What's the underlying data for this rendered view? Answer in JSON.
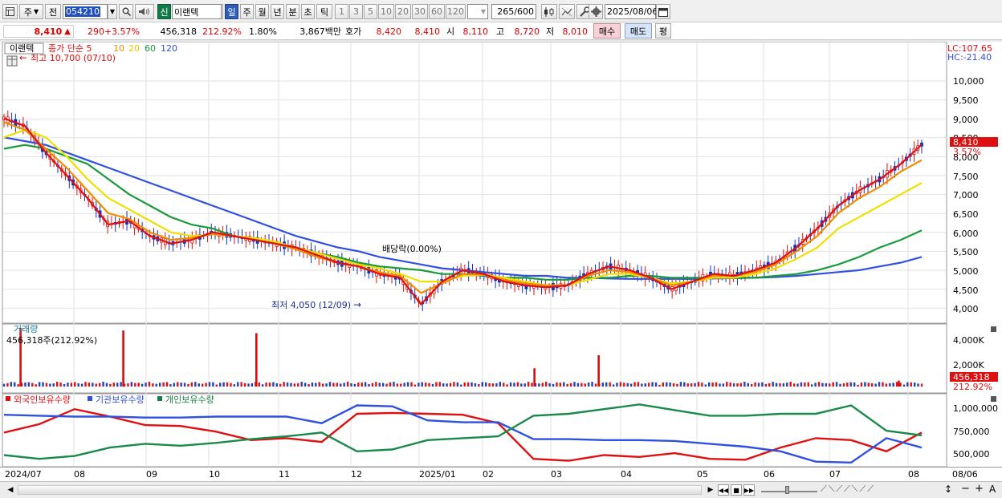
{
  "toolbar": {
    "type_label": "주",
    "prev_label": "전",
    "code": "054210",
    "new_badge": "신",
    "name": "이랜텍",
    "periods": [
      "일",
      "주",
      "월",
      "년",
      "분",
      "초",
      "틱"
    ],
    "active_period": "일",
    "intervals": [
      "1",
      "3",
      "5",
      "10",
      "20",
      "30",
      "60",
      "120"
    ],
    "count": "265",
    "count_max": "/600",
    "date": "2025/08/06"
  },
  "quote": {
    "price": "8,410",
    "change": "290",
    "change_pct": "+3.57%",
    "volume": "456,318",
    "volume_ratio": "212.92%",
    "turnover": "1.80%",
    "amount": "3,867백만",
    "hoga_label": "호가",
    "ask": "8,420",
    "bid": "8,410",
    "open_label": "시",
    "open": "8,110",
    "high_label": "고",
    "high": "8,720",
    "low_label": "저",
    "low": "8,010",
    "buy_label": "매수",
    "sell_label": "매도",
    "avg_label": "평"
  },
  "price_panel": {
    "legend_name": "이랜텍",
    "legend_ma": "종가 단순 5",
    "ma_periods": [
      "10",
      "20",
      "60",
      "120"
    ],
    "max_note": "최고 10,700 (07/10)",
    "min_note": "최저 4,050 (12/09)",
    "dividend_note": "배당락(0.00%)",
    "lc": "LC:107.65",
    "hc": "HC:-21.40",
    "y_ticks": [
      "10,000",
      "9,500",
      "9,000",
      "8,500",
      "8,000",
      "7,500",
      "7,000",
      "6,500",
      "6,000",
      "5,500",
      "5,000",
      "4,500",
      "4,000"
    ],
    "current_price_tag": "8,410",
    "current_pct_tag": "3.57%",
    "colors": {
      "ma5": "#e01010",
      "ma10": "#f08c00",
      "ma20": "#f0e000",
      "ma60": "#1a9a3a",
      "ma120": "#3050e0"
    }
  },
  "volume_panel": {
    "title": "거래량",
    "value": "456,318주(212.92%)",
    "y_ticks": [
      "4,000K",
      "2,000K"
    ],
    "tag_value": "456,318",
    "tag_pct": "212.92%"
  },
  "holding_panel": {
    "foreign": "외국인보유수량",
    "inst": "기관보유수량",
    "individual": "개인보유수량",
    "y_ticks": [
      "1,000,000",
      "750,000",
      "500,000"
    ]
  },
  "x_axis": {
    "labels": [
      "2024/07",
      "08",
      "09",
      "10",
      "11",
      "12",
      "2025/01",
      "02",
      "03",
      "04",
      "05",
      "06",
      "07",
      "08"
    ],
    "right_label": "08/06"
  },
  "chart_data": [
    {
      "type": "line",
      "title": "",
      "y_axis": "price",
      "ylim": [
        3800,
        10700
      ],
      "series": [
        {
          "name": "종가 단순 5",
          "values": [
            9100,
            8900,
            8200,
            7600,
            7000,
            6300,
            6400,
            6000,
            5800,
            5900,
            6100,
            6000,
            5900,
            5800,
            5700,
            5500,
            5300,
            5200,
            5000,
            4900,
            4200,
            4800,
            5100,
            5000,
            4800,
            4700,
            4650,
            4700,
            5000,
            5200,
            5100,
            4900,
            4600,
            4800,
            5000,
            4950,
            5100,
            5300,
            5700,
            6200,
            6800,
            7200,
            7500,
            7900,
            8410
          ]
        },
        {
          "name": "10",
          "values": [
            9000,
            8800,
            8300,
            7800,
            7200,
            6600,
            6450,
            6100,
            5900,
            5950,
            6050,
            6000,
            5900,
            5800,
            5650,
            5450,
            5300,
            5200,
            5050,
            4950,
            4500,
            4750,
            5000,
            4980,
            4850,
            4750,
            4700,
            4700,
            4950,
            5100,
            5050,
            4900,
            4700,
            4800,
            4950,
            4950,
            5050,
            5250,
            5600,
            6000,
            6600,
            7000,
            7300,
            7700,
            8000
          ]
        },
        {
          "name": "20",
          "values": [
            8600,
            8800,
            8600,
            8100,
            7500,
            7000,
            6700,
            6400,
            6100,
            6000,
            6050,
            6000,
            5950,
            5850,
            5700,
            5550,
            5400,
            5250,
            5150,
            5000,
            4800,
            4800,
            4950,
            4980,
            4900,
            4800,
            4700,
            4700,
            4850,
            5000,
            5000,
            4900,
            4750,
            4800,
            4900,
            4900,
            5000,
            5150,
            5400,
            5700,
            6200,
            6500,
            6800,
            7100,
            7400
          ]
        },
        {
          "name": "60",
          "values": [
            8300,
            8400,
            8300,
            8100,
            7900,
            7500,
            7100,
            6800,
            6500,
            6300,
            6200,
            6000,
            5900,
            5800,
            5700,
            5550,
            5450,
            5300,
            5200,
            5150,
            5100,
            5000,
            5000,
            4950,
            4900,
            4900,
            4850,
            4850,
            4900,
            4900,
            4950,
            4950,
            4900,
            4900,
            4900,
            4900,
            4900,
            4950,
            5000,
            5100,
            5250,
            5450,
            5700,
            5900,
            6150
          ]
        },
        {
          "name": "120",
          "values": [
            8600,
            8500,
            8400,
            8200,
            8000,
            7800,
            7600,
            7400,
            7200,
            7000,
            6800,
            6600,
            6400,
            6200,
            6000,
            5850,
            5700,
            5600,
            5450,
            5350,
            5250,
            5150,
            5100,
            5050,
            5000,
            4950,
            4950,
            4900,
            4900,
            4880,
            4870,
            4870,
            4870,
            4870,
            4880,
            4890,
            4900,
            4920,
            4950,
            5000,
            5050,
            5100,
            5200,
            5300,
            5450
          ]
        }
      ]
    },
    {
      "type": "bar",
      "title": "거래량",
      "y_axis": "volume (K)",
      "ylim": [
        0,
        4800
      ],
      "spikes": [
        {
          "x": 0.018,
          "value": 4500
        },
        {
          "x": 0.13,
          "value": 4300
        },
        {
          "x": 0.275,
          "value": 4100
        },
        {
          "x": 0.578,
          "value": 1400
        },
        {
          "x": 0.648,
          "value": 2400
        },
        {
          "x": 0.975,
          "value": 456
        }
      ]
    },
    {
      "type": "line",
      "title": "",
      "y_axis": "holdings",
      "ylim": [
        430000,
        1080000
      ],
      "series": [
        {
          "name": "외국인보유수량",
          "values": [
            760000,
            850000,
            1010000,
            930000,
            840000,
            830000,
            770000,
            680000,
            700000,
            660000,
            960000,
            970000,
            960000,
            950000,
            860000,
            480000,
            460000,
            520000,
            500000,
            540000,
            480000,
            470000,
            600000,
            700000,
            680000,
            560000,
            760000
          ]
        },
        {
          "name": "기관보유수량",
          "values": [
            950000,
            940000,
            930000,
            930000,
            920000,
            920000,
            930000,
            930000,
            930000,
            860000,
            1050000,
            1040000,
            890000,
            870000,
            870000,
            690000,
            690000,
            680000,
            680000,
            670000,
            640000,
            610000,
            560000,
            450000,
            440000,
            700000,
            600000
          ]
        },
        {
          "name": "개인보유수량",
          "values": [
            520000,
            480000,
            510000,
            600000,
            640000,
            620000,
            650000,
            690000,
            720000,
            760000,
            560000,
            580000,
            680000,
            700000,
            720000,
            940000,
            960000,
            1010000,
            1060000,
            1000000,
            940000,
            940000,
            960000,
            960000,
            1050000,
            780000,
            730000
          ]
        }
      ]
    }
  ]
}
